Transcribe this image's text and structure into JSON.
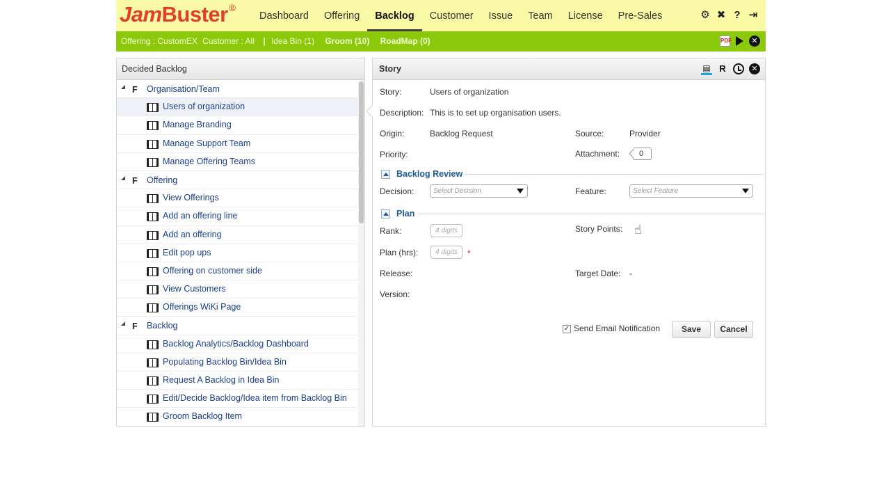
{
  "header": {
    "logo_jam": "Jam",
    "logo_buster": "Buster",
    "logo_reg": "®",
    "nav": [
      "Dashboard",
      "Offering",
      "Backlog",
      "Customer",
      "Issue",
      "Team",
      "License",
      "Pre-Sales"
    ],
    "active_nav": "Backlog",
    "icons": [
      "settings-key-icon",
      "tools-icon",
      "help-icon",
      "logout-icon"
    ]
  },
  "context_bar": {
    "offering": "Offering : CustomEX",
    "customer": "Customer : All",
    "separator": "|",
    "idea_bin": "Idea Bin (1)",
    "groom": "Groom (10)",
    "roadmap": "RoadMap (0)",
    "pdf_label": "PDF"
  },
  "left_panel": {
    "title": "Decided Backlog",
    "feature_tag": "F",
    "groups": [
      {
        "label": "Organisation/Team",
        "stories": [
          "Users of organization",
          "Manage Branding",
          "Manage Support Team",
          "Manage Offering Teams"
        ]
      },
      {
        "label": "Offering",
        "stories": [
          "View Offerings",
          "Add an offering line",
          "Add an offering",
          "Edit pop ups",
          "Offering on customer side",
          "View Customers",
          "Offerings WiKi Page"
        ]
      },
      {
        "label": "Backlog",
        "stories": [
          "Backlog Analytics/Backlog Dashboard",
          "Populating Backlog Bin/Idea Bin",
          "Request A Backlog in Idea Bin",
          "Edit/Decide Backlog/Idea item from Backlog Bin",
          "Groom Backlog Item"
        ]
      }
    ],
    "selected_story": "Users of organization"
  },
  "story_panel": {
    "title": "Story",
    "r_label": "R",
    "story_label": "Story:",
    "story_value": "Users of organization",
    "description_label": "Description:",
    "description_value": "This is to set up organisation users.",
    "origin_label": "Origin:",
    "origin_value": "Backlog Request",
    "source_label": "Source:",
    "source_value": "Provider",
    "priority_label": "Priority:",
    "attachment_label": "Attachment:",
    "attachment_count": "0",
    "backlog_review_title": "Backlog Review",
    "decision_label": "Decision:",
    "decision_placeholder": "Select Decision",
    "feature_label": "Feature:",
    "feature_placeholder": "Select Feature",
    "plan_title": "Plan",
    "rank_label": "Rank:",
    "rank_placeholder": "4 digits",
    "story_points_label": "Story Points:",
    "plan_hrs_label": "Plan (hrs):",
    "plan_hrs_placeholder": "4 digits",
    "required_mark": "*",
    "release_label": "Release:",
    "target_date_label": "Target Date:",
    "target_date_value": "-",
    "version_label": "Version:",
    "email_checkbox_label": "Send Email Notification",
    "email_checked": true,
    "save_label": "Save",
    "cancel_label": "Cancel"
  },
  "colors": {
    "header_bg": "#fafaa6",
    "context_bar_bg": "#8cc90a",
    "logo": "#e0402a",
    "link": "#1b3f8b",
    "section_title": "#1b5b99"
  }
}
